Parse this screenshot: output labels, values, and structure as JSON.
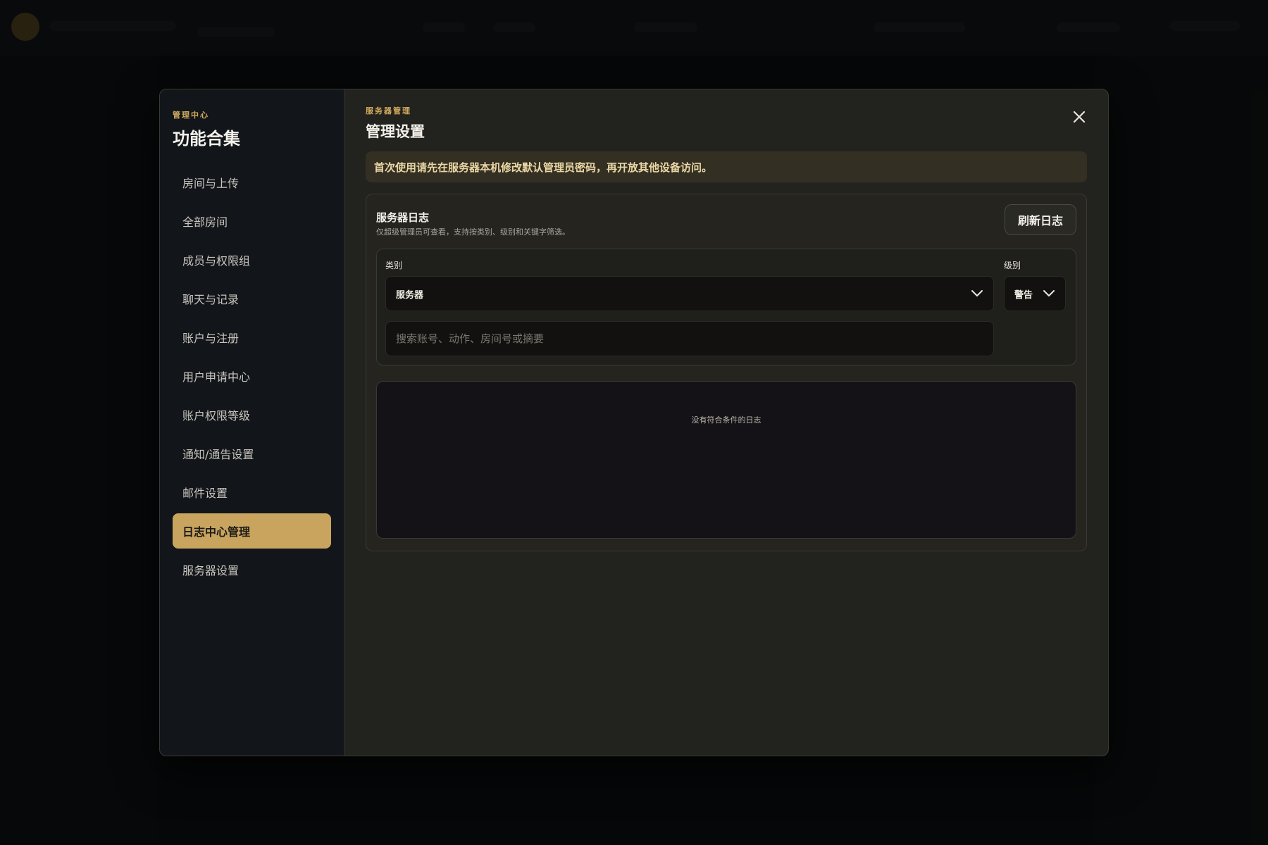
{
  "sidebar": {
    "kicker": "管理中心",
    "title": "功能合集",
    "items": [
      {
        "label": "房间与上传"
      },
      {
        "label": "全部房间"
      },
      {
        "label": "成员与权限组"
      },
      {
        "label": "聊天与记录"
      },
      {
        "label": "账户与注册"
      },
      {
        "label": "用户申请中心"
      },
      {
        "label": "账户权限等级"
      },
      {
        "label": "通知/通告设置"
      },
      {
        "label": "邮件设置"
      },
      {
        "label": "日志中心管理",
        "active": true
      },
      {
        "label": "服务器设置"
      }
    ]
  },
  "main": {
    "kicker": "服务器管理",
    "title": "管理设置",
    "notice": "首次使用请先在服务器本机修改默认管理员密码，再开放其他设备访问。",
    "panel": {
      "title": "服务器日志",
      "subtitle": "仅超级管理员可查看，支持按类别、级别和关键字筛选。",
      "refresh_label": "刷新日志",
      "category_label": "类别",
      "category_value": "服务器",
      "level_label": "级别",
      "level_value": "警告",
      "search_placeholder": "搜索账号、动作、房间号或摘要",
      "search_value": "",
      "empty_text": "没有符合条件的日志"
    }
  },
  "icons": {
    "close": "close-icon",
    "chevron": "chevron-down-icon"
  },
  "colors": {
    "accent": "#c9a45f",
    "notice_bg": "#332f22",
    "sidebar_bg": "#12161a",
    "panel_bg": "#25241f"
  }
}
